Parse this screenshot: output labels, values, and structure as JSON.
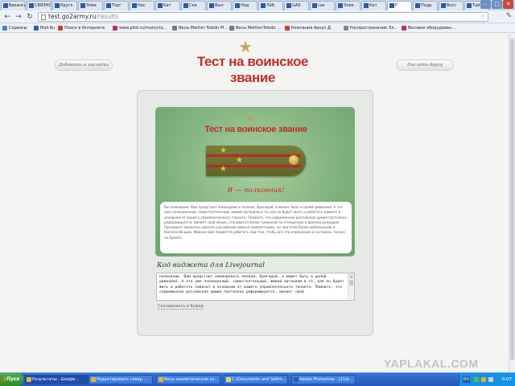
{
  "browser": {
    "tabs": [
      {
        "label": "Вакансии",
        "active": false
      },
      {
        "label": "СВЯЗНОЙ",
        "active": false
      },
      {
        "label": "Кругл",
        "active": false
      },
      {
        "label": "Элек",
        "active": false
      },
      {
        "label": "Торг",
        "active": false
      },
      {
        "label": "Нас",
        "active": false
      },
      {
        "label": "Кат",
        "active": false
      },
      {
        "label": "Сев",
        "active": false
      },
      {
        "label": "Выл",
        "active": false
      },
      {
        "label": "Над",
        "active": false
      },
      {
        "label": "Лаб",
        "active": false
      },
      {
        "label": "GAS",
        "active": false
      },
      {
        "label": "cas",
        "active": false
      },
      {
        "label": "Элек",
        "active": false
      },
      {
        "label": "Кат",
        "active": false
      },
      {
        "label": "Р",
        "active": true
      },
      {
        "label": "Подр",
        "active": false
      },
      {
        "label": "Восс",
        "active": false
      },
      {
        "label": "Тайм",
        "active": false
      }
    ],
    "url_host": "test.go2army.ru",
    "url_path": "/results",
    "window_buttons": {
      "minimize": "–",
      "maximize": "□",
      "close": "✕"
    },
    "bookmarks": [
      {
        "label": "Сервисы",
        "color": "#4a7fd0"
      },
      {
        "label": "Mail.Ru",
        "color": "#2a5fb8"
      },
      {
        "label": "Поиск в Интернете",
        "color": "#d53a2f"
      },
      {
        "label": "www.pilot.ru/main/cto...",
        "color": "#c0314f"
      },
      {
        "label": "Весы Mettler Toledo М...",
        "color": "#7a7a7a"
      },
      {
        "label": "Весы Mettler-Toledo ...",
        "color": "#7a7a7a"
      },
      {
        "label": "Компания Аркус-Д",
        "color": "#d53a2f"
      },
      {
        "label": "Распространение Эл...",
        "color": "#888888"
      },
      {
        "label": "Весовое оборудован...",
        "color": "#c0314f"
      }
    ]
  },
  "page": {
    "bookmark_pill": "Добавить в закладки",
    "share_pill": "Послать другу",
    "site_title": "Тест на воинское звание",
    "card_title": "Тест на воинское звание",
    "rank_result": "Я — полковник!",
    "description": "Вы полковник. Вам предстоит командовать полком, бригадой, а может быть и целой дивизией. А это уже полноценный, самостоятельный, живой организм и то, как он будет жить и работать зависит в основном от вашего управленческого таланта. Помните, что современная российская армия постоянно реформируется, меняет свой облик, становится более гуманной по отношению к военнослужащим. Президент приказал сделать российские войска компактными, но при этом более мобильными и боеспособными. Именно вам придется работать над тем, чтобы все эти изменения не остались только на бумаге.",
    "widget_title": "Код виджета для Livejournal",
    "widget_code": "полковник. Вам предстоит командовать полком, бригадой, а может быть и целой дивизией. А это уже полноценный, самостоятельный, живой организм и то, как он будет жить и работать зависит в основном от вашего управленческого таланта. Помните, что современная российская армия постоянно реформируется, меняет свой",
    "copy_link": "Скопировать в буфер"
  },
  "watermark": "YAPLAKAL.COM",
  "taskbar": {
    "start_label": "Пуск",
    "tasks": [
      {
        "label": "Результаты - Google...",
        "color": "#e8b33a",
        "active": true
      },
      {
        "label": "Редактировать товар -...",
        "color": "#e8b33a",
        "active": false
      },
      {
        "label": "Весы аналитические се...",
        "color": "#e8b33a",
        "active": false
      },
      {
        "label": "C:\\Documents and Settin...",
        "color": "#f0d060",
        "active": false
      },
      {
        "label": "Adobe Photoshop - [11/e...",
        "color": "#2a5ca8",
        "active": false
      }
    ],
    "language": "RU",
    "clock": "0:07"
  },
  "colors": {
    "accent_red": "#c62b2b",
    "card_green": "#84b47f",
    "gold": "#e3c040"
  }
}
